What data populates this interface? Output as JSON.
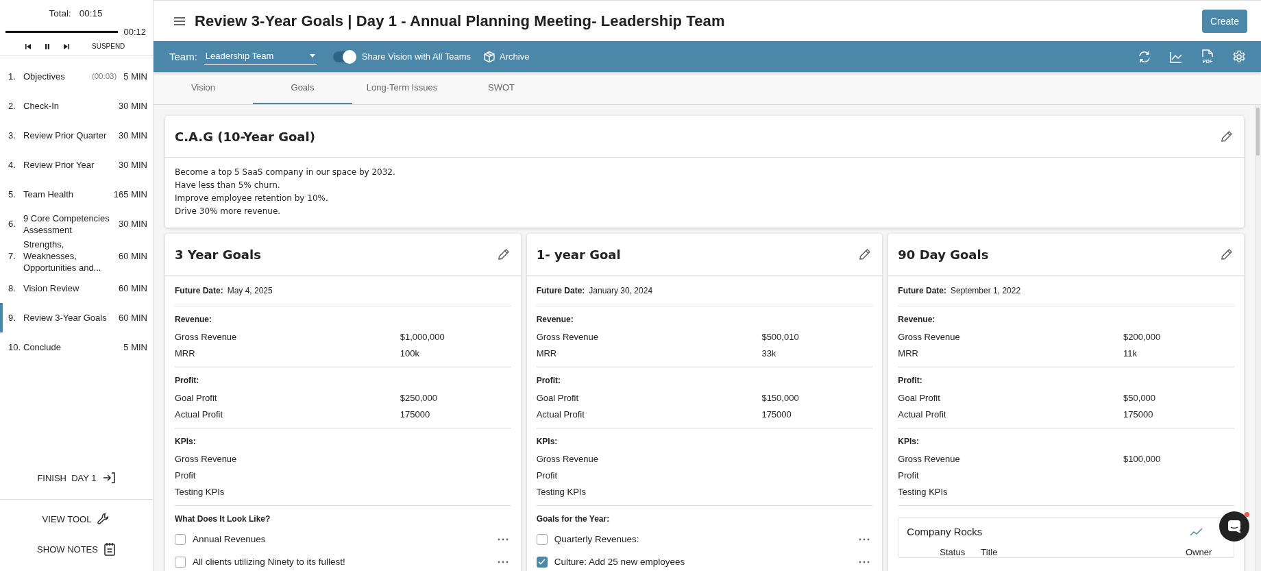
{
  "sidebar": {
    "timer": {
      "total_label": "Total:",
      "total": "00:15",
      "level": 1,
      "elapsed": "00:12",
      "controls": [
        {
          "kind": "previous"
        },
        {
          "kind": "pause"
        },
        {
          "kind": "next"
        }
      ],
      "suspend": "SUSPEND"
    },
    "agenda": [
      {
        "number": "1.",
        "title": "Objectives",
        "elapsed": "(00:03)",
        "duration": "5 MIN",
        "selected": false
      },
      {
        "number": "2.",
        "title": "Check-In",
        "duration": "30 MIN",
        "selected": false
      },
      {
        "number": "3.",
        "title": "Review Prior Quarter",
        "duration": "30 MIN",
        "selected": false
      },
      {
        "number": "4.",
        "title": "Review Prior Year",
        "duration": "30 MIN",
        "selected": false
      },
      {
        "number": "5.",
        "title": "Team Health",
        "duration": "165 MIN",
        "selected": false
      },
      {
        "number": "6.",
        "title": "9 Core Competencies Assessment",
        "duration": "30 MIN",
        "selected": false
      },
      {
        "number": "7.",
        "title": "Strengths, Weaknesses, Opportunities and...",
        "duration": "60 MIN",
        "selected": false
      },
      {
        "number": "8.",
        "title": "Vision Review",
        "duration": "60 MIN",
        "selected": false
      },
      {
        "number": "9.",
        "title": "Review 3-Year Goals",
        "duration": "60 MIN",
        "selected": true
      },
      {
        "number": "10.",
        "title": "Conclude",
        "duration": "5 MIN",
        "selected": false
      }
    ],
    "finish": "FINISH  DAY 1",
    "actions": [
      {
        "kind": "tool",
        "label": "VIEW TOOL"
      },
      {
        "kind": "notes",
        "label": "SHOW NOTES"
      }
    ]
  },
  "header": {
    "title": "Review 3-Year Goals | Day 1 - Annual Planning Meeting- Leadership Team",
    "create_button": "Create"
  },
  "toolbar": {
    "team_label": "Team:",
    "team_value": "Leadership Team",
    "share_toggle": {
      "label": "Share Vision with All Teams",
      "on": true
    },
    "archive": "Archive",
    "icons": [
      {
        "kind": "refresh"
      },
      {
        "kind": "chart"
      },
      {
        "kind": "pdf",
        "label": "PDF"
      },
      {
        "kind": "settings"
      }
    ]
  },
  "tabs": [
    {
      "label": "Vision",
      "selected": false
    },
    {
      "label": "Goals",
      "selected": true
    },
    {
      "label": "Long-Term Issues",
      "selected": false
    },
    {
      "label": "SWOT",
      "selected": false
    }
  ],
  "cag": {
    "title": "C.A.G (10-Year Goal)",
    "lines": [
      "Become a top 5 SaaS company in our space by 2032.",
      "Have less than 5% churn.",
      "Improve employee retention by 10%.",
      "Drive 30% more revenue."
    ]
  },
  "goal_cards": [
    {
      "title": "3 Year Goals",
      "future_date_label": "Future Date:",
      "future_date": "May 4, 2025",
      "sections": [
        {
          "kind": "fields",
          "heading": "Revenue:",
          "rows": [
            {
              "label": "Gross Revenue",
              "value": "$1,000,000"
            },
            {
              "label": "MRR",
              "value": "100k"
            }
          ]
        },
        {
          "kind": "fields",
          "heading": "Profit:",
          "rows": [
            {
              "label": "Goal Profit",
              "value": "$250,000"
            },
            {
              "label": "Actual Profit",
              "value": "175000"
            }
          ]
        },
        {
          "kind": "fields",
          "heading": "KPIs:",
          "rows": [
            {
              "label": "Gross Revenue"
            },
            {
              "label": "Profit"
            },
            {
              "label": "Testing KPIs"
            }
          ]
        },
        {
          "kind": "checklist",
          "heading": "What Does It Look Like?",
          "items": [
            {
              "label": "Annual Revenues",
              "checked": false
            },
            {
              "label": "All clients utilizing Ninety to its fullest!",
              "checked": false
            }
          ]
        }
      ]
    },
    {
      "title": "1- year Goal",
      "future_date_label": "Future Date:",
      "future_date": "January 30, 2024",
      "sections": [
        {
          "kind": "fields",
          "heading": "Revenue:",
          "rows": [
            {
              "label": "Gross Revenue",
              "value": "$500,010"
            },
            {
              "label": "MRR",
              "value": "33k"
            }
          ]
        },
        {
          "kind": "fields",
          "heading": "Profit:",
          "rows": [
            {
              "label": "Goal Profit",
              "value": "$150,000"
            },
            {
              "label": "Actual Profit",
              "value": "175000"
            }
          ]
        },
        {
          "kind": "fields",
          "heading": "KPIs:",
          "rows": [
            {
              "label": "Gross Revenue"
            },
            {
              "label": "Profit"
            },
            {
              "label": "Testing KPIs"
            }
          ]
        },
        {
          "kind": "checklist",
          "heading": "Goals for the Year:",
          "items": [
            {
              "label": "Quarterly Revenues:",
              "checked": false
            },
            {
              "label": "Culture: Add 25 new employees",
              "checked": true
            }
          ]
        }
      ]
    },
    {
      "title": "90 Day Goals",
      "future_date_label": "Future Date:",
      "future_date": "September 1, 2022",
      "sections": [
        {
          "kind": "fields",
          "heading": "Revenue:",
          "rows": [
            {
              "label": "Gross Revenue",
              "value": "$200,000"
            },
            {
              "label": "MRR",
              "value": "11k"
            }
          ]
        },
        {
          "kind": "fields",
          "heading": "Profit:",
          "rows": [
            {
              "label": "Goal Profit",
              "value": "$50,000"
            },
            {
              "label": "Actual Profit",
              "value": "175000"
            }
          ]
        },
        {
          "kind": "fields",
          "heading": "KPIs:",
          "rows": [
            {
              "label": "Gross Revenue",
              "value": "$100,000"
            },
            {
              "label": "Profit"
            },
            {
              "label": "Testing KPIs"
            }
          ]
        },
        {
          "kind": "rocks",
          "title": "Company Rocks",
          "columns": [
            "Status",
            "Title",
            "Owner"
          ]
        }
      ]
    }
  ]
}
